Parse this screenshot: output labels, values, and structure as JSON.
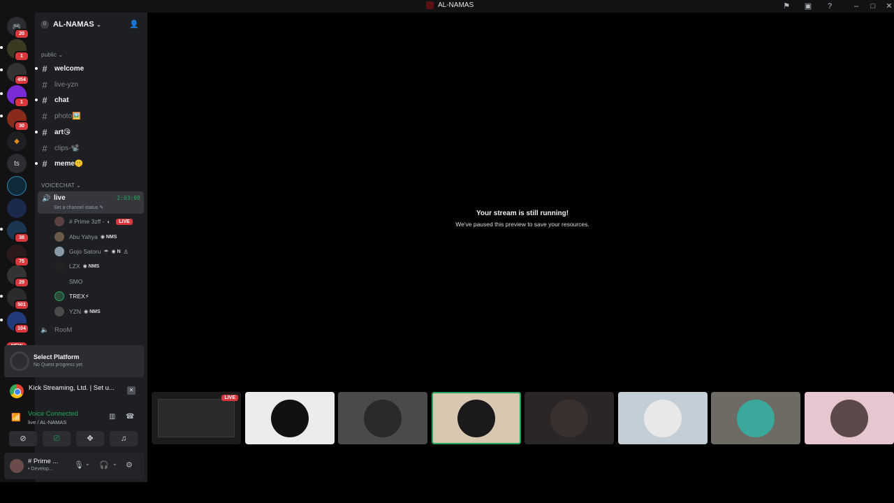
{
  "window": {
    "title": "AL-NAMAS"
  },
  "rail": {
    "badges": [
      "20",
      "1",
      "454",
      "1",
      "30",
      "38",
      "75",
      "29",
      "501",
      "104"
    ],
    "ts_label": "ts",
    "new_label": "NEW"
  },
  "server": {
    "name": "AL-NAMAS",
    "boost": "0"
  },
  "categories": {
    "public": "public",
    "voice": "VOICECHAT"
  },
  "channels": [
    {
      "name": "welcome",
      "unread": true
    },
    {
      "name": "live-yzn",
      "unread": false
    },
    {
      "name": "chat",
      "unread": true
    },
    {
      "name": "photo🖼️",
      "unread": false
    },
    {
      "name": "art😘",
      "unread": true
    },
    {
      "name": "clips-📽️",
      "unread": false
    },
    {
      "name": "meme🤫",
      "unread": true
    }
  ],
  "voice_channel": {
    "name": "live",
    "timer": "2:03:08",
    "status": "Set a channel status"
  },
  "members": [
    {
      "name": "# Prime 3zff -",
      "live": "LIVE"
    },
    {
      "name": "Abu Yahya",
      "tag": "NMS"
    },
    {
      "name": "Gojo Satoru",
      "tag": "N"
    },
    {
      "name": "LZX",
      "tag": "NMS"
    },
    {
      "name": "SMO"
    },
    {
      "name": "TREX⚡"
    },
    {
      "name": "YZN",
      "tag": "NMS"
    }
  ],
  "room": {
    "name": "RooM"
  },
  "quest": {
    "title": "Select Platform",
    "subtitle": "No Quest progress yet"
  },
  "activity": {
    "text": "Kick Streaming, Ltd. | Set u..."
  },
  "voice": {
    "status": "Voice Connected",
    "location": "live / AL-NAMAS"
  },
  "user": {
    "name": "# Prime ...",
    "sub": "• Develop..."
  },
  "stage": {
    "heading": "Your stream is still running!",
    "subtext": "We've paused this preview to save your resources."
  },
  "tiles": [
    {
      "bg": "#1c1c1c",
      "av": "none",
      "live": "LIVE"
    },
    {
      "bg": "#ececec",
      "av": "#111111"
    },
    {
      "bg": "#4a4a4a",
      "av": "#2a2a2a"
    },
    {
      "bg": "#d8c8b2",
      "av": "#1a1a1a",
      "active": true
    },
    {
      "bg": "#2a2626",
      "av": "#3a3030"
    },
    {
      "bg": "#c3ced6",
      "av": "#e8e8e8"
    },
    {
      "bg": "#6e6a64",
      "av": "#3aa89a"
    },
    {
      "bg": "#e7c7cf",
      "av": "#5a4a4a"
    }
  ],
  "colors": {
    "accent_green": "#23a55a",
    "danger_red": "#da373c"
  }
}
